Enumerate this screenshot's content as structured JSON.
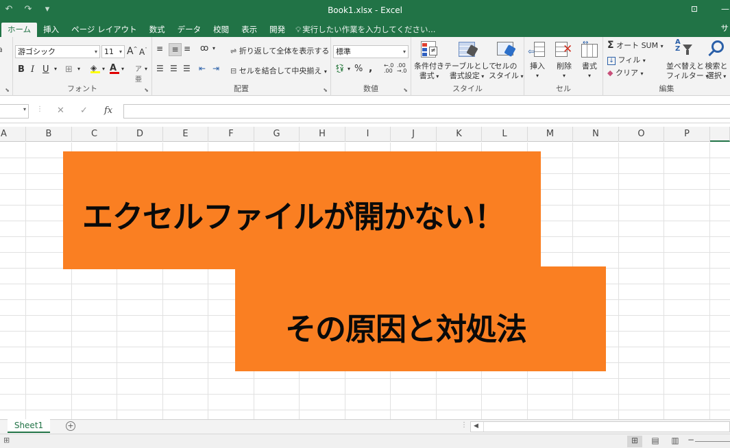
{
  "window": {
    "title": "Book1.xlsx - Excel"
  },
  "tabs": [
    "ホーム",
    "挿入",
    "ページ レイアウト",
    "数式",
    "データ",
    "校閲",
    "表示",
    "開発"
  ],
  "tell_me": "実行したい作業を入力してください...",
  "signin": "サ",
  "font": {
    "name": "游ゴシック",
    "size": "11",
    "group_label": "フォント"
  },
  "alignment": {
    "wrap_label": "折り返して全体を表示する",
    "merge_label": "セルを結合して中央揃え",
    "group_label": "配置"
  },
  "number": {
    "format": "標準",
    "group_label": "数値"
  },
  "styles": {
    "conditional": [
      "条件付き",
      "書式"
    ],
    "table": [
      "テーブルとして",
      "書式設定"
    ],
    "cell": [
      "セルの",
      "スタイル"
    ],
    "group_label": "スタイル"
  },
  "cells": {
    "insert": "挿入",
    "delete": "削除",
    "format": "書式",
    "group_label": "セル"
  },
  "editing": {
    "autosum": "オート SUM",
    "fill": "フィル",
    "clear": "クリア",
    "sort": [
      "並べ替えと",
      "フィルター"
    ],
    "find": [
      "検索と",
      "選択"
    ],
    "group_label": "編集"
  },
  "formula_bar": {
    "fx": "fx"
  },
  "columns": [
    "A",
    "B",
    "C",
    "D",
    "E",
    "F",
    "G",
    "H",
    "I",
    "J",
    "K",
    "L",
    "M",
    "N",
    "O",
    "P"
  ],
  "banner": {
    "headline": "エクセルファイルが開かない！",
    "subhead": "その原因と対処法",
    "color": "#fa7f22"
  },
  "sheets": [
    "Sheet1"
  ],
  "accent": "#217346"
}
